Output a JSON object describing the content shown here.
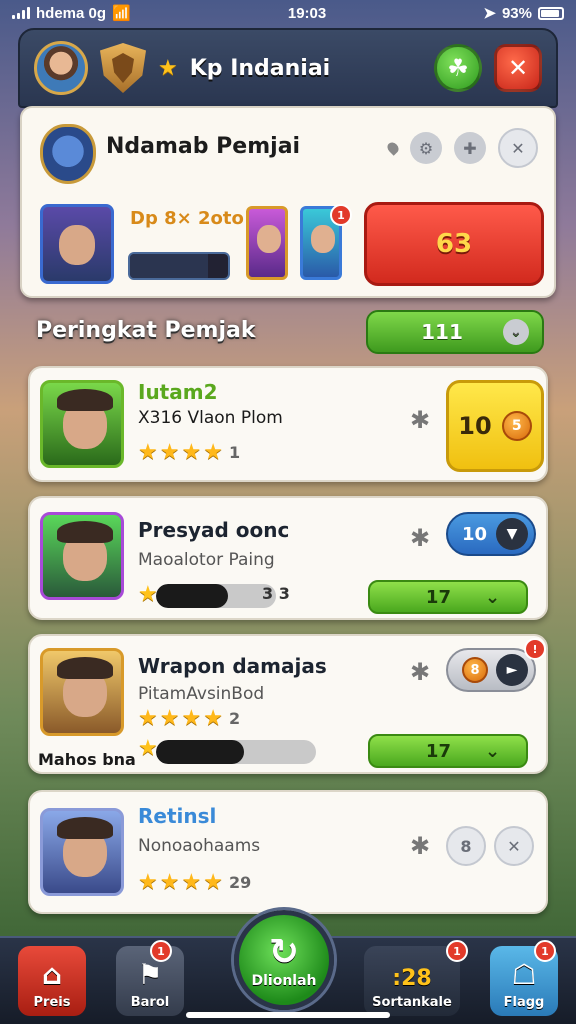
{
  "status_bar": {
    "carrier": "hdema 0g",
    "time": "19:03",
    "battery": "93%"
  },
  "header": {
    "title": "Kp Indaniai"
  },
  "profile": {
    "name": "Ndamab Pemjai",
    "stat_text": "Dp 8× 2oto",
    "main_button_label": "63",
    "thumb_badge": "1"
  },
  "leaderboard": {
    "heading": "Peringkat Pemjak",
    "filter_value": "111",
    "rows": [
      {
        "title": "Iutam2",
        "subtitle": "X316 Vlaon Plom",
        "stars": 4,
        "star_count": "1",
        "reward_value": "10",
        "reward_coin": "5"
      },
      {
        "title": "Presyad oonc",
        "subtitle": "Maoalotor Paing",
        "progress": 0.6,
        "progress_text": "3 3",
        "pill_value": "10",
        "green_value": "17"
      },
      {
        "title": "Wrapon damajas",
        "subtitle": "PitamAvsinBod",
        "stars": 4,
        "star_count": "2",
        "progress": 0.55,
        "pill_value": "8",
        "green_value": "17",
        "caption": "Mahos bna"
      },
      {
        "title": "Retinsl",
        "subtitle": "Nonoaohaams",
        "stars": 4,
        "star_count": "29",
        "action_value": "8"
      }
    ]
  },
  "bottom_nav": {
    "items": [
      {
        "label": "Preis",
        "icon": "home-icon"
      },
      {
        "label": "Barol",
        "icon": "flag-icon",
        "badge": "1"
      },
      {
        "label": "Dlionlah",
        "icon": "refresh-icon"
      },
      {
        "label": "Sortankale",
        "coins": ":28",
        "icon": "coin-icon",
        "badge": "1"
      },
      {
        "label": "Flagg",
        "icon": "house-icon",
        "badge": "1"
      }
    ]
  },
  "colors": {
    "header_bg": "#2a3650",
    "primary_red": "#d22a1e",
    "primary_green": "#3f9a1e",
    "gold": "#ffc21a"
  }
}
